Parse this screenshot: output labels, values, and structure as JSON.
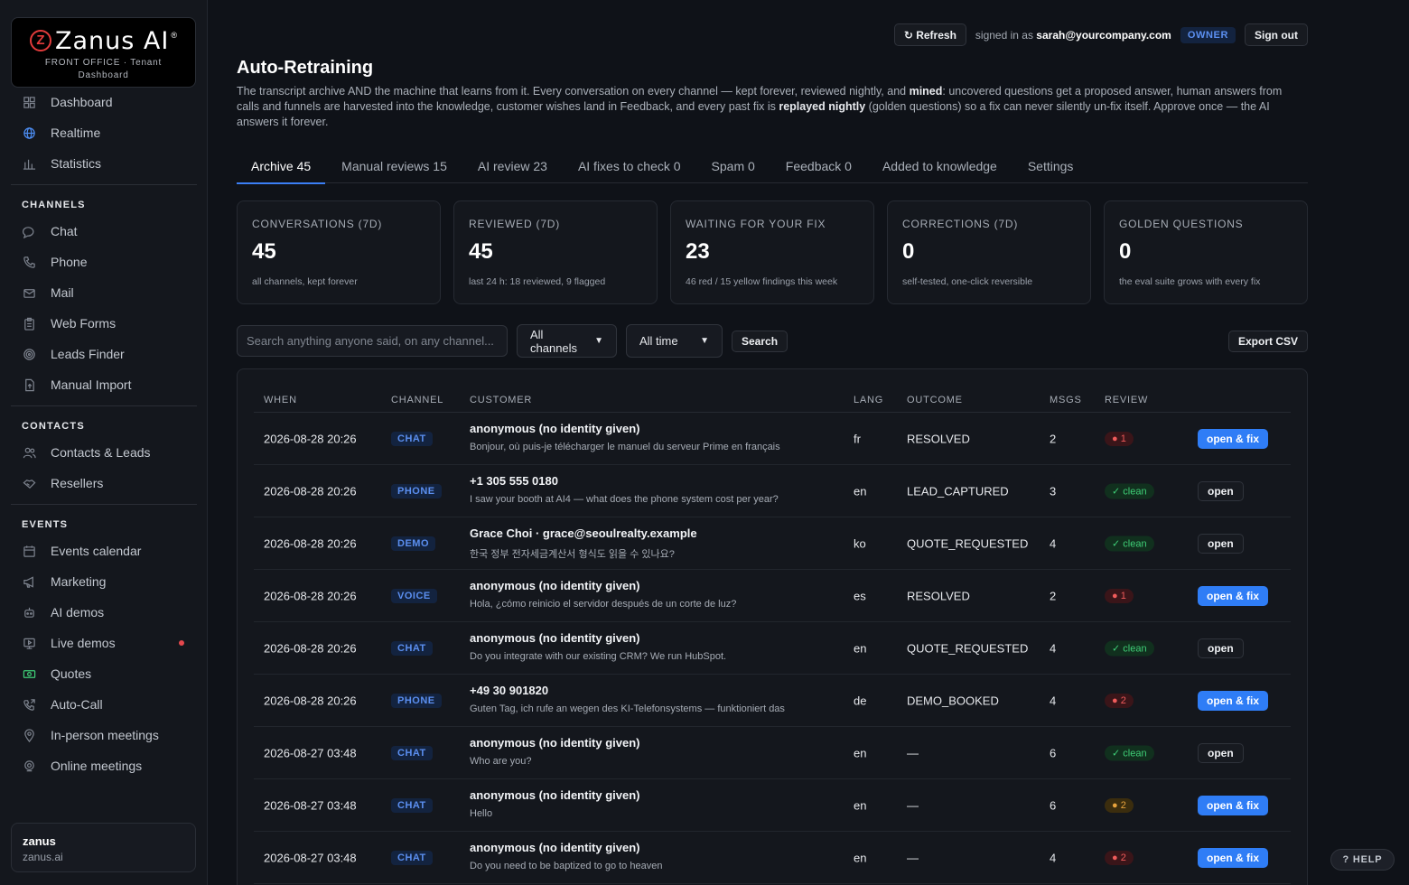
{
  "brand": {
    "name": "Zanus AI",
    "mark": "Z",
    "reg": "®",
    "subtitle": "FRONT OFFICE · Tenant Dashboard",
    "accent": "#e23b3b"
  },
  "sidebar": {
    "top_items": [
      {
        "label": "Dashboard",
        "icon": "grid-icon"
      },
      {
        "label": "Realtime",
        "icon": "globe-icon"
      },
      {
        "label": "Statistics",
        "icon": "bar-chart-icon"
      }
    ],
    "sections": {
      "channels": "CHANNELS",
      "contacts": "CONTACTS",
      "events": "EVENTS"
    },
    "channels": [
      {
        "label": "Chat",
        "icon": "chat-bubble-icon"
      },
      {
        "label": "Phone",
        "icon": "phone-icon"
      },
      {
        "label": "Mail",
        "icon": "mail-icon"
      },
      {
        "label": "Web Forms",
        "icon": "clipboard-icon"
      },
      {
        "label": "Leads Finder",
        "icon": "target-icon"
      },
      {
        "label": "Manual Import",
        "icon": "file-upload-icon"
      }
    ],
    "contacts": [
      {
        "label": "Contacts & Leads",
        "icon": "users-icon"
      },
      {
        "label": "Resellers",
        "icon": "handshake-icon"
      }
    ],
    "events": [
      {
        "label": "Events calendar",
        "icon": "calendar-icon"
      },
      {
        "label": "Marketing",
        "icon": "megaphone-icon"
      },
      {
        "label": "AI demos",
        "icon": "robot-icon"
      },
      {
        "label": "Live demos",
        "icon": "monitor-icon"
      },
      {
        "label": "Quotes",
        "icon": "banknote-icon"
      },
      {
        "label": "Auto-Call",
        "icon": "phone-outgoing-icon"
      },
      {
        "label": "In-person meetings",
        "icon": "map-pin-icon"
      },
      {
        "label": "Online meetings",
        "icon": "webcam-icon"
      }
    ],
    "tenant": {
      "name": "zanus",
      "domain": "zanus.ai"
    }
  },
  "topbar": {
    "refresh_label": "↻ Refresh",
    "signed_in_prefix": "signed in as",
    "email": "sarah@yourcompany.com",
    "role": "OWNER",
    "signout_label": "Sign out"
  },
  "page": {
    "title": "Auto-Retraining",
    "desc": {
      "p1": "The transcript archive AND the machine that learns from it. Every conversation on every channel — kept forever, reviewed nightly, and ",
      "b1": "mined",
      "p2": ": uncovered questions get a proposed answer, human answers from calls and funnels are harvested into the knowledge, customer wishes land in Feedback, and every past fix is ",
      "b2": "replayed nightly",
      "p3": " (golden questions) so a fix can never silently un-fix itself. Approve once — the AI answers it forever."
    }
  },
  "tabs": [
    {
      "label": "Archive 45",
      "active": true
    },
    {
      "label": "Manual reviews 15",
      "active": false
    },
    {
      "label": "AI review 23",
      "active": false
    },
    {
      "label": "AI fixes to check 0",
      "active": false
    },
    {
      "label": "Spam 0",
      "active": false
    },
    {
      "label": "Feedback 0",
      "active": false
    },
    {
      "label": "Added to knowledge",
      "active": false
    },
    {
      "label": "Settings",
      "active": false
    }
  ],
  "stats": [
    {
      "label": "CONVERSATIONS (7D)",
      "value": "45",
      "sub": "all channels, kept forever"
    },
    {
      "label": "REVIEWED (7D)",
      "value": "45",
      "sub": "last 24 h: 18 reviewed, 9 flagged"
    },
    {
      "label": "WAITING FOR YOUR FIX",
      "value": "23",
      "sub": "46 red / 15 yellow findings this week"
    },
    {
      "label": "CORRECTIONS (7D)",
      "value": "0",
      "sub": "self-tested, one-click reversible"
    },
    {
      "label": "GOLDEN QUESTIONS",
      "value": "0",
      "sub": "the eval suite grows with every fix"
    }
  ],
  "filters": {
    "search_placeholder": "Search anything anyone said, on any channel...",
    "channel_value": "All channels",
    "time_value": "All time",
    "search_label": "Search",
    "export_label": "Export CSV"
  },
  "table": {
    "headers": [
      "WHEN",
      "CHANNEL",
      "CUSTOMER",
      "LANG",
      "OUTCOME",
      "MSGS",
      "REVIEW"
    ],
    "rows": [
      {
        "when": "2026-08-28 20:26",
        "channel": "CHAT",
        "name": "anonymous (no identity given)",
        "msg": "Bonjour, où puis-je télécharger le manuel du serveur Prime en français",
        "lang": "fr",
        "outcome": "RESOLVED",
        "msgs": "2",
        "review": "● 1",
        "review_kind": "red",
        "action": "open & fix",
        "action_kind": "primary"
      },
      {
        "when": "2026-08-28 20:26",
        "channel": "PHONE",
        "name": "+1 305 555 0180",
        "msg": "I saw your booth at AI4 — what does the phone system cost per year?",
        "lang": "en",
        "outcome": "LEAD_CAPTURED",
        "msgs": "3",
        "review": "✓ clean",
        "review_kind": "green",
        "action": "open",
        "action_kind": "plain"
      },
      {
        "when": "2026-08-28 20:26",
        "channel": "DEMO",
        "name": "Grace Choi · grace@seoulrealty.example",
        "msg": "한국 정부 전자세금계산서 형식도 읽을 수 있나요?",
        "lang": "ko",
        "outcome": "QUOTE_REQUESTED",
        "msgs": "4",
        "review": "✓ clean",
        "review_kind": "green",
        "action": "open",
        "action_kind": "plain"
      },
      {
        "when": "2026-08-28 20:26",
        "channel": "VOICE",
        "name": "anonymous (no identity given)",
        "msg": "Hola, ¿cómo reinicio el servidor después de un corte de luz?",
        "lang": "es",
        "outcome": "RESOLVED",
        "msgs": "2",
        "review": "● 1",
        "review_kind": "red",
        "action": "open & fix",
        "action_kind": "primary"
      },
      {
        "when": "2026-08-28 20:26",
        "channel": "CHAT",
        "name": "anonymous (no identity given)",
        "msg": "Do you integrate with our existing CRM? We run HubSpot.",
        "lang": "en",
        "outcome": "QUOTE_REQUESTED",
        "msgs": "4",
        "review": "✓ clean",
        "review_kind": "green",
        "action": "open",
        "action_kind": "plain"
      },
      {
        "when": "2026-08-28 20:26",
        "channel": "PHONE",
        "name": "+49 30 901820",
        "msg": "Guten Tag, ich rufe an wegen des KI-Telefonsystems — funktioniert das",
        "lang": "de",
        "outcome": "DEMO_BOOKED",
        "msgs": "4",
        "review": "● 2",
        "review_kind": "red",
        "action": "open & fix",
        "action_kind": "primary"
      },
      {
        "when": "2026-08-27 03:48",
        "channel": "CHAT",
        "name": "anonymous (no identity given)",
        "msg": "Who are you?",
        "lang": "en",
        "outcome": "—",
        "msgs": "6",
        "review": "✓ clean",
        "review_kind": "green",
        "action": "open",
        "action_kind": "plain"
      },
      {
        "when": "2026-08-27 03:48",
        "channel": "CHAT",
        "name": "anonymous (no identity given)",
        "msg": "Hello",
        "lang": "en",
        "outcome": "—",
        "msgs": "6",
        "review": "● 2",
        "review_kind": "yellow",
        "action": "open & fix",
        "action_kind": "primary"
      },
      {
        "when": "2026-08-27 03:48",
        "channel": "CHAT",
        "name": "anonymous (no identity given)",
        "msg": "Do you need to be baptized to go to heaven",
        "lang": "en",
        "outcome": "—",
        "msgs": "4",
        "review": "● 2",
        "review_kind": "red",
        "action": "open & fix",
        "action_kind": "primary"
      }
    ]
  },
  "help_label": "? HELP"
}
